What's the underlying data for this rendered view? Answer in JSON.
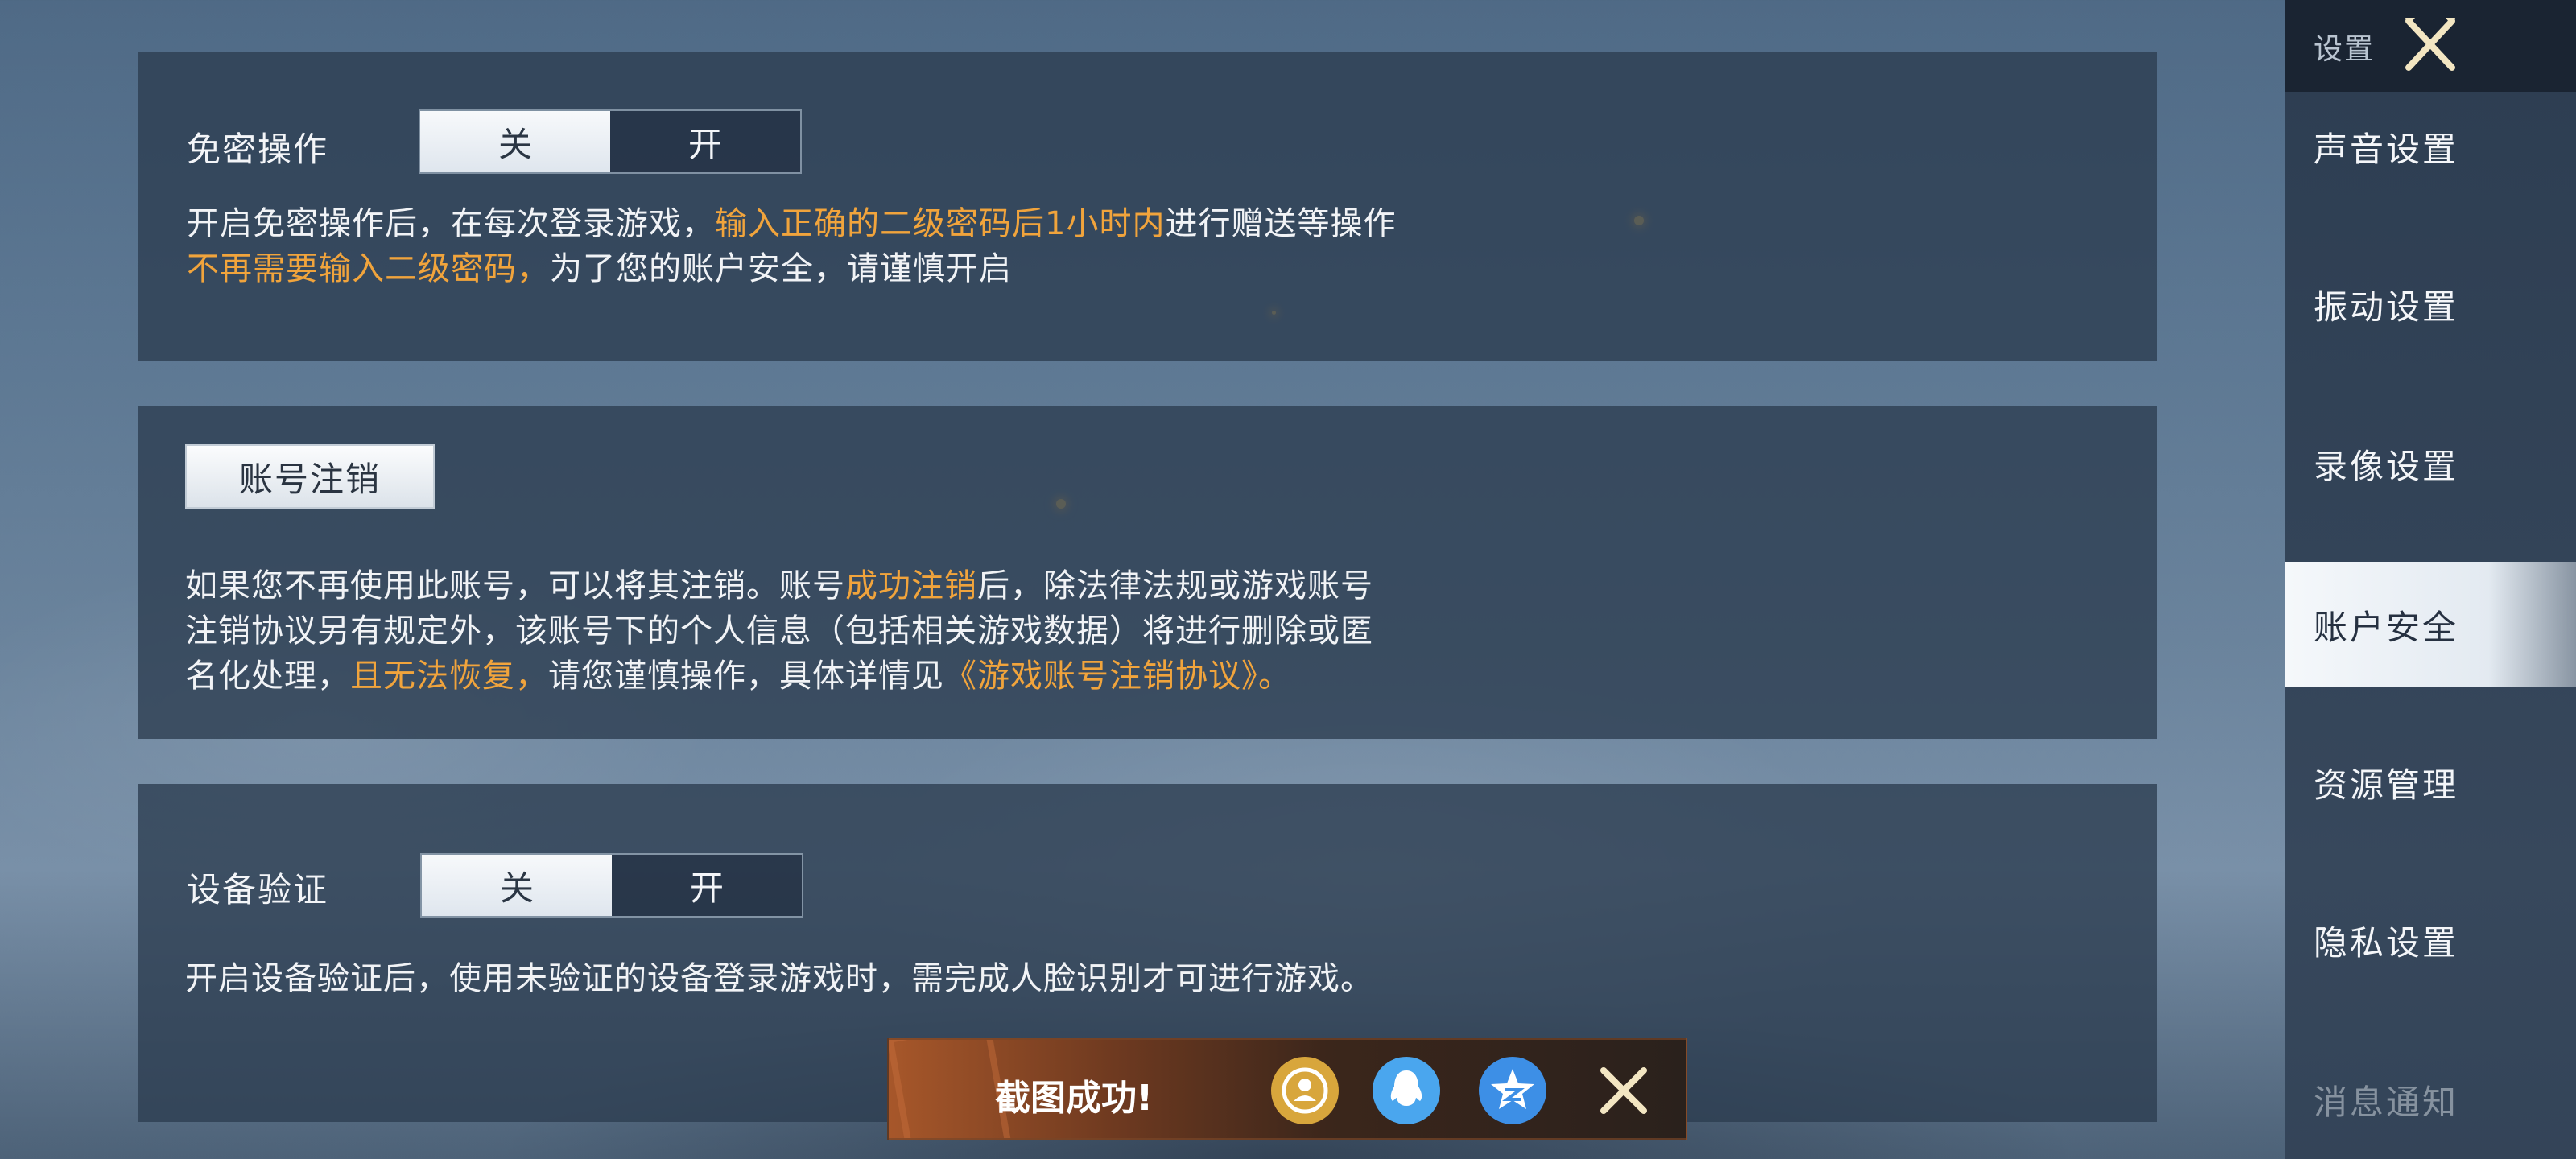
{
  "privacy_free": {
    "label": "免密操作",
    "toggle": {
      "off": "关",
      "on": "开",
      "selected": "关"
    },
    "desc_line1_a": "开启免密操作后，在每次登录游戏，",
    "desc_line1_hl": "输入正确的二级密码后1小时内",
    "desc_line1_b": "进行赠送等操作",
    "desc_line2_hl": "不再需要输入二级密码，",
    "desc_line2_b": "为了您的账户安全，请谨慎开启"
  },
  "account_cancel": {
    "button": "账号注销",
    "line1_a": "如果您不再使用此账号，可以将其注销。账号",
    "line1_hl": "成功注销",
    "line1_b": "后，除法律法规或游戏账号",
    "line2": "注销协议另有规定外，该账号下的个人信息（包括相关游戏数据）将进行删除或匿",
    "line3_a": "名化处理，",
    "line3_hl": "且无法恢复，",
    "line3_b": "请您谨慎操作，具体详情见",
    "line3_link": "《游戏账号注销协议》。"
  },
  "device_verify": {
    "label": "设备验证",
    "toggle": {
      "off": "关",
      "on": "开",
      "selected": "关"
    },
    "desc": "开启设备验证后，使用未验证的设备登录游戏时，需完成人脸识别才可进行游戏。"
  },
  "sidebar": {
    "title": "设置",
    "items": [
      {
        "label": "声音设置"
      },
      {
        "label": "振动设置"
      },
      {
        "label": "录像设置"
      },
      {
        "label": "账户安全"
      },
      {
        "label": "资源管理"
      },
      {
        "label": "隐私设置"
      },
      {
        "label": "消息通知"
      }
    ],
    "active_index": 3
  },
  "toast": {
    "text": "截图成功!",
    "share_icons": [
      "wechat-moments-icon",
      "qq-icon",
      "qzone-icon"
    ],
    "colors": {
      "moments": "#d8a63c",
      "qq": "#4aa6ee",
      "qzone": "#3d8fe6"
    }
  },
  "colors": {
    "highlight": "#f1a43c"
  }
}
